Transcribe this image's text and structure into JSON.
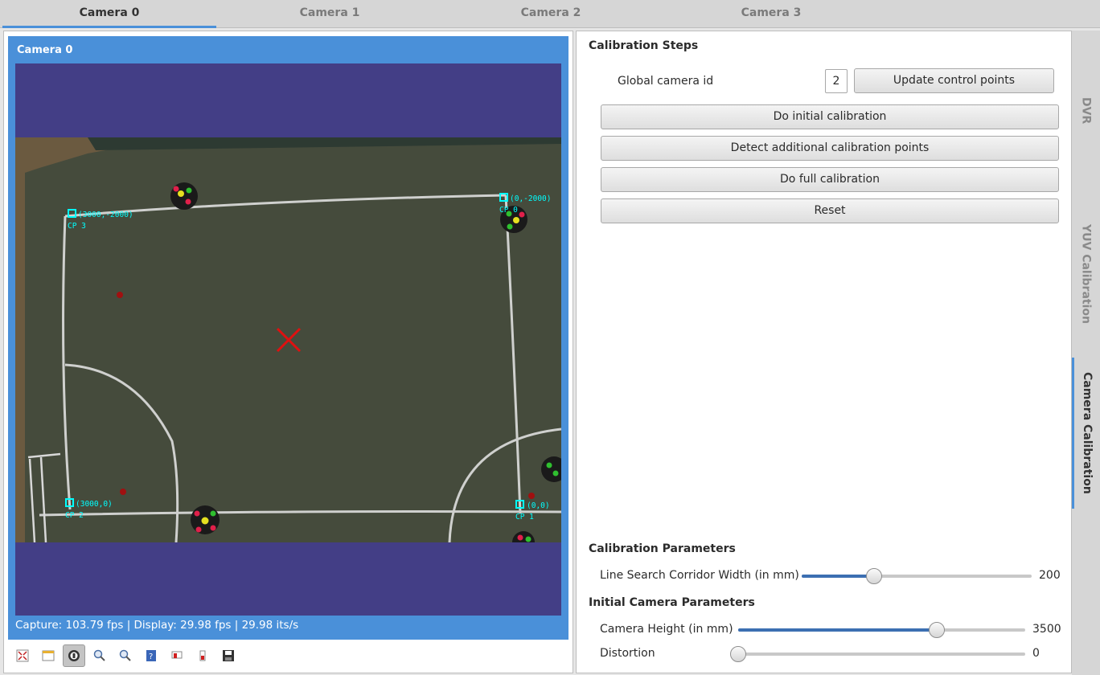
{
  "camera_tabs": [
    {
      "label": "Camera 0",
      "active": true
    },
    {
      "label": "Camera 1",
      "active": false
    },
    {
      "label": "Camera 2",
      "active": false
    },
    {
      "label": "Camera 3",
      "active": false
    }
  ],
  "video": {
    "title": "Camera 0",
    "status": "Capture: 103.79 fps | Display: 29.98 fps | 29.98 its/s",
    "control_points": [
      {
        "coords": "(0,-2000)",
        "label": "CP 0"
      },
      {
        "coords": "(0,0)",
        "label": "CP 1"
      },
      {
        "coords": "(3000,0)",
        "label": "CP 2"
      },
      {
        "coords": "(3000,-2000)",
        "label": "CP 3"
      }
    ]
  },
  "toolbar": {
    "tools": [
      "fullscreen-icon",
      "open-window-icon",
      "pause-icon",
      "zoom-in-icon",
      "zoom-out-icon",
      "help-icon",
      "record-icon",
      "record-stop-icon",
      "save-icon"
    ],
    "active_tool": "pause-icon"
  },
  "calibration_steps": {
    "title": "Calibration Steps",
    "global_id_label": "Global camera id",
    "global_id_value": "2",
    "update_button": "Update control points",
    "initial_button": "Do initial calibration",
    "detect_button": "Detect additional calibration points",
    "full_button": "Do full calibration",
    "reset_button": "Reset"
  },
  "calibration_parameters": {
    "title": "Calibration Parameters",
    "corridor_label": "Line Search Corridor Width (in mm)",
    "corridor_value": "200",
    "corridor_fraction": 0.315
  },
  "initial_parameters": {
    "title": "Initial Camera Parameters",
    "height_label": "Camera Height (in mm)",
    "height_value": "3500",
    "height_fraction": 0.691,
    "distortion_label": "Distortion",
    "distortion_value": "0",
    "distortion_fraction": 0.0
  },
  "side_tabs": [
    {
      "label": "DVR",
      "active": false
    },
    {
      "label": "YUV Calibration",
      "active": false
    },
    {
      "label": "Camera Calibration",
      "active": true
    }
  ],
  "colors": {
    "accent": "#4a90d9",
    "overlay": "#00ffff",
    "marker": "#e01010",
    "letterbox": "#433e86"
  }
}
